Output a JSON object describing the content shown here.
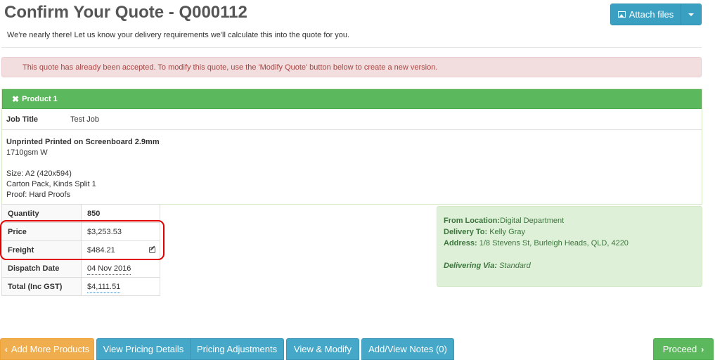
{
  "header": {
    "title": "Confirm Your Quote - Q000112",
    "subtitle": "We're nearly there! Let us know your delivery requirements we'll calculate this into the quote for you.",
    "attach_label": "Attach files"
  },
  "alert": {
    "text": "This quote has already been accepted. To modify this quote, use the 'Modify Quote' button below to create a new version."
  },
  "product": {
    "heading": "Product 1",
    "job_title_label": "Job Title",
    "job_title_value": "Test Job",
    "material": "Unprinted Printed on Screenboard 2.9mm",
    "weight": "1710gsm W",
    "size": "Size: A2 (420x594)",
    "pack": "Carton Pack, Kinds Split 1",
    "proof": "Proof: Hard Proofs"
  },
  "pricing": {
    "quantity_label": "Quantity",
    "quantity_value": "850",
    "price_label": "Price",
    "price_value": "$3,253.53",
    "freight_label": "Freight",
    "freight_value": "$484.21",
    "dispatch_label": "Dispatch Date",
    "dispatch_value": "04 Nov 2016",
    "total_label": "Total (Inc GST)",
    "total_value": "$4,111.51"
  },
  "delivery": {
    "from_label": "From Location:",
    "from_value": "Digital Department",
    "to_label": "Delivery To:",
    "to_value": "Kelly Gray",
    "address_label": "Address:",
    "address_value": "1/8 Stevens St, Burleigh Heads, QLD, 4220",
    "via_label": "Delivering Via:",
    "via_value": "Standard"
  },
  "footer": {
    "add_more": "Add More Products",
    "pricing_details": "View Pricing Details",
    "pricing_adjustments": "Pricing Adjustments",
    "view_modify": "View & Modify",
    "notes": "Add/View Notes (0)",
    "proceed": "Proceed"
  },
  "icons": {
    "attach": "image-icon",
    "dropdown": "caret-down-icon",
    "collapse": "close-icon",
    "edit": "edit-icon",
    "back": "chevron-left-icon",
    "forward": "chevron-right-icon"
  },
  "colors": {
    "success": "#5cb85c",
    "info": "#46a8c9",
    "warning": "#f0ad4e",
    "danger_bg": "#f2dede",
    "highlight": "#e00000"
  }
}
